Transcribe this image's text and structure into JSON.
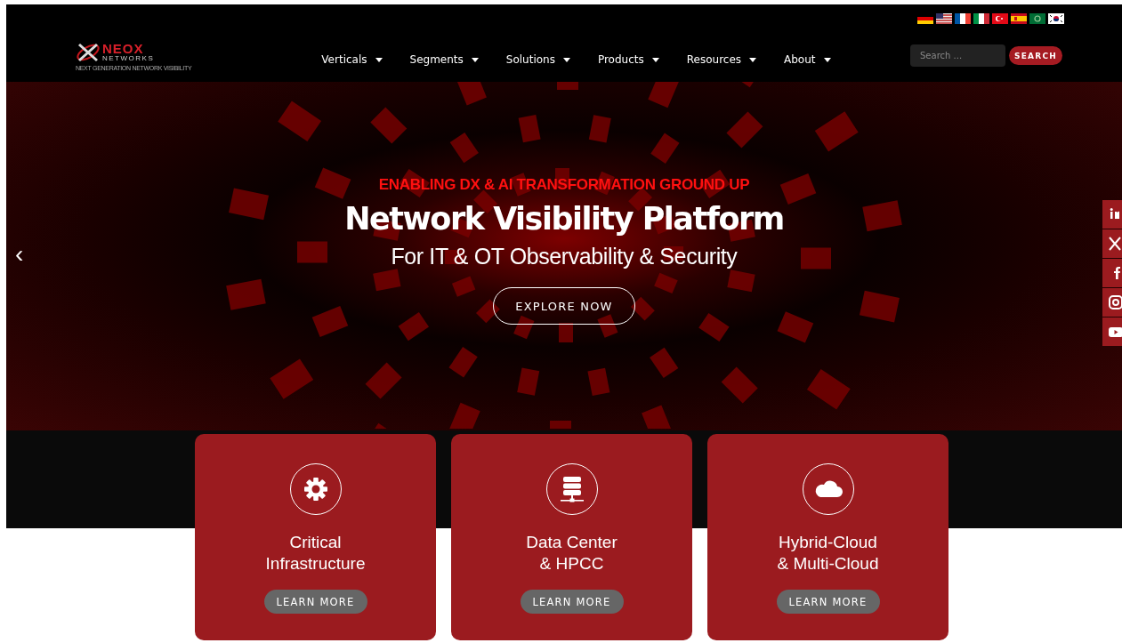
{
  "logo": {
    "name": "NEOX",
    "sub": "NETWORKS",
    "tagline": "NEXT GENERATION NETWORK VISIBILITY"
  },
  "nav": [
    {
      "label": "Verticals"
    },
    {
      "label": "Segments"
    },
    {
      "label": "Solutions"
    },
    {
      "label": "Products"
    },
    {
      "label": "Resources"
    },
    {
      "label": "About"
    }
  ],
  "search": {
    "placeholder": "Search ...",
    "button": "SEARCH"
  },
  "hero": {
    "eyebrow": "ENABLING DX & AI TRANSFORMATION GROUND UP",
    "title": "Network Visibility Platform",
    "subtitle": "For IT & OT Observability & Security",
    "button": "EXPLORE NOW",
    "prev": "‹"
  },
  "cards": [
    {
      "title": "Critical\nInfrastructure",
      "button": "LEARN MORE"
    },
    {
      "title": "Data Center\n& HPCC",
      "button": "LEARN MORE"
    },
    {
      "title": "Hybrid-Cloud\n& Multi-Cloud",
      "button": "LEARN MORE"
    }
  ]
}
